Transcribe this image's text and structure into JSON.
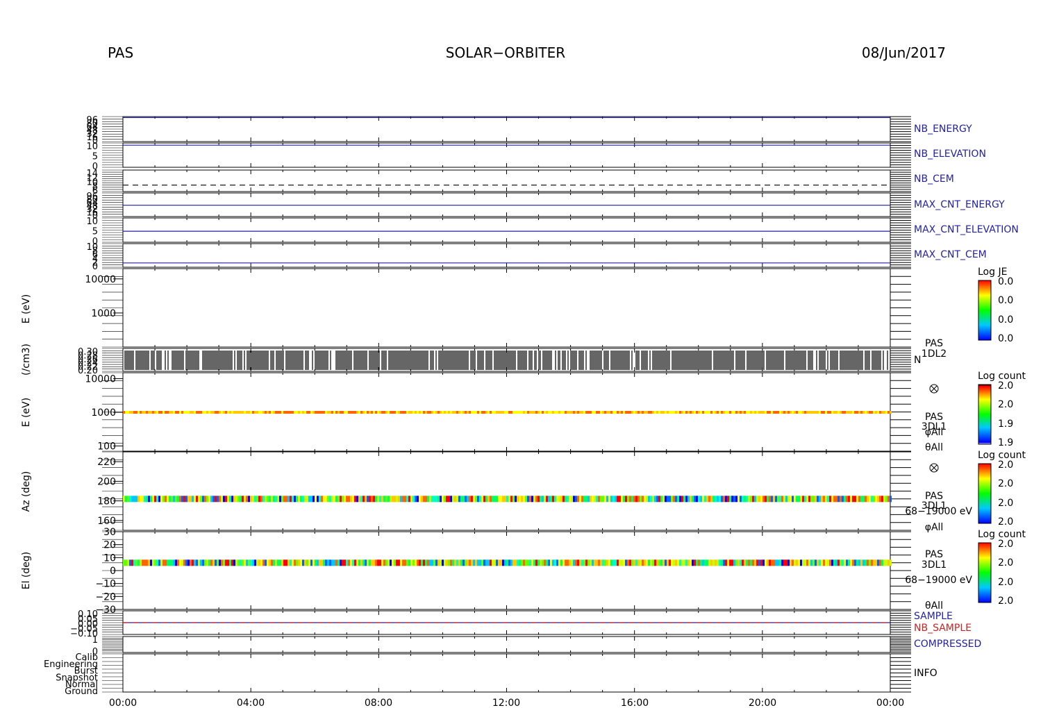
{
  "header": {
    "instrument": "PAS",
    "mission": "SOLAR−ORBITER",
    "date": "08/Jun/2017"
  },
  "colors": {
    "axis": "#000000",
    "label_blue": "#1f1fa8",
    "label_red": "#cc2222"
  },
  "chart_data": [
    {
      "type": "line",
      "name": "panel-nb-energy",
      "x_range": [
        "00:00",
        "24:00"
      ],
      "ytick_labels": [
        "96",
        "80",
        "64",
        "48",
        "32",
        "16",
        "0"
      ],
      "series": [
        {
          "name": "NB_ENERGY",
          "color": "#1f1fa8",
          "values": [
            96,
            96
          ]
        }
      ],
      "ylim": [
        0,
        100
      ],
      "labels": [
        "NB_ENERGY"
      ]
    },
    {
      "type": "line",
      "name": "panel-nb-elevation",
      "x_range": [
        "00:00",
        "24:00"
      ],
      "ytick_labels": [
        "10",
        "5",
        "0"
      ],
      "series": [
        {
          "name": "NB_ELEVATION",
          "color": "#1f1fa8",
          "values": [
            10,
            10
          ]
        }
      ],
      "ylim": [
        0,
        11
      ],
      "labels": [
        "NB_ELEVATION"
      ]
    },
    {
      "type": "line",
      "name": "panel-nb-cem",
      "x_range": [
        "00:00",
        "24:00"
      ],
      "ytick_labels": [
        "14",
        "12",
        "10",
        "8",
        "6"
      ],
      "series": [
        {
          "name": "NB_CEM",
          "color": "#000000",
          "style": "dashed",
          "values": [
            8,
            8
          ]
        }
      ],
      "ylim": [
        5,
        15
      ],
      "labels": [
        "NB_CEM"
      ]
    },
    {
      "type": "line",
      "name": "panel-max-cnt-energy",
      "x_range": [
        "00:00",
        "24:00"
      ],
      "ytick_labels": [
        "96",
        "80",
        "64",
        "48",
        "32",
        "16",
        "0"
      ],
      "series": [
        {
          "name": "MAX_CNT_ENERGY",
          "color": "#1f1fa8",
          "values": [
            48,
            48
          ]
        }
      ],
      "ylim": [
        0,
        100
      ],
      "labels": [
        "MAX_CNT_ENERGY"
      ]
    },
    {
      "type": "line",
      "name": "panel-max-cnt-elevation",
      "x_range": [
        "00:00",
        "24:00"
      ],
      "ytick_labels": [
        "10",
        "5",
        "0"
      ],
      "series": [
        {
          "name": "MAX_CNT_ELEVATION",
          "color": "#1f1fa8",
          "values": [
            5,
            5
          ]
        }
      ],
      "ylim": [
        0,
        11
      ],
      "labels": [
        "MAX_CNT_ELEVATION"
      ]
    },
    {
      "type": "line",
      "name": "panel-max-cnt-cem",
      "x_range": [
        "00:00",
        "24:00"
      ],
      "ytick_labels": [
        "10",
        "8",
        "6",
        "4",
        "2",
        "0"
      ],
      "series": [
        {
          "name": "MAX_CNT_CEM",
          "color": "#1f1fa8",
          "values": [
            2,
            2
          ]
        }
      ],
      "ylim": [
        0,
        11
      ],
      "labels": [
        "MAX_CNT_CEM"
      ]
    },
    {
      "type": "heatmap",
      "name": "panel-energy-je",
      "ylabel": "E (eV)",
      "yticks": [
        10000,
        1000
      ],
      "yscale": "log",
      "ylim": [
        100,
        20000
      ],
      "colorbar": {
        "title": "Log JE",
        "ticks": [
          "0.0",
          "0.0",
          "0.0",
          "0.0"
        ]
      }
    },
    {
      "type": "bar",
      "name": "panel-density",
      "ylabel": "(/cm3)",
      "ytick_labels": [
        "0.30",
        "0.28",
        "0.26",
        "0.24",
        "0.22",
        "0.20"
      ],
      "ylim": [
        0.2,
        0.3
      ],
      "series_labels": [
        "PAS",
        "1DL2",
        "N"
      ]
    },
    {
      "type": "heatmap",
      "name": "panel-energy-3dl1",
      "ylabel": "E (eV)",
      "yticks": [
        10000,
        1000,
        100
      ],
      "yscale": "log",
      "ylim": [
        70,
        15000
      ],
      "band_center": 1000,
      "colorbar": {
        "title": "Log count",
        "ticks": [
          "2.0",
          "2.0",
          "1.9",
          "1.9"
        ]
      },
      "series_labels": [
        "PAS",
        "3DL1",
        "φAll",
        "θAll"
      ]
    },
    {
      "type": "heatmap",
      "name": "panel-azimuth",
      "ylabel": "Az (deg)",
      "yticks": [
        220,
        200,
        180,
        160
      ],
      "ylim": [
        150,
        230
      ],
      "band_center": 182,
      "colorbar": {
        "title": "Log count",
        "ticks": [
          "2.0",
          "2.0",
          "2.0",
          "2.0"
        ]
      },
      "series_labels": [
        "PAS",
        "3DL1",
        "68−19000 eV",
        "φAll"
      ]
    },
    {
      "type": "heatmap",
      "name": "panel-elevation",
      "ylabel": "El (deg)",
      "yticks": [
        30,
        20,
        10,
        0,
        -10,
        -20,
        -30
      ],
      "ytick_labels": [
        "30",
        "20",
        "10",
        "0",
        "−10",
        "−20",
        "−30"
      ],
      "ylim": [
        -30,
        30
      ],
      "band_center": 6,
      "colorbar": {
        "title": "Log count",
        "ticks": [
          "2.0",
          "2.0",
          "2.0",
          "2.0"
        ]
      },
      "series_labels": [
        "PAS",
        "3DL1",
        "68−19000 eV",
        "θAll"
      ]
    },
    {
      "type": "line",
      "name": "panel-sample",
      "ytick_labels": [
        "0.10",
        "0.05",
        "0.00",
        "−0.05",
        "−0.10"
      ],
      "ylim": [
        -0.1,
        0.1
      ],
      "series": [
        {
          "name": "SAMPLE",
          "color": "#1f1fa8",
          "values": [
            0,
            0
          ]
        },
        {
          "name": "NB_SAMPLE",
          "color": "#cc2222",
          "style": "dashed",
          "values": [
            0,
            0
          ]
        }
      ],
      "labels": [
        "SAMPLE",
        "NB_SAMPLE"
      ]
    },
    {
      "type": "line",
      "name": "panel-compressed",
      "ytick_labels": [
        "1",
        "0"
      ],
      "ylim": [
        0,
        1
      ],
      "series": [
        {
          "name": "COMPRESSED",
          "color": "#1f1fa8",
          "values": []
        }
      ],
      "labels": [
        "COMPRESSED"
      ]
    },
    {
      "type": "line",
      "name": "panel-info",
      "ytick_labels": [
        "Calib",
        "Engineering",
        "Burst",
        "Snapshot",
        "Normal",
        "Ground"
      ],
      "series": [
        {
          "name": "INFO",
          "color": "#1f1fa8",
          "values": []
        }
      ],
      "labels": [
        "INFO"
      ]
    }
  ],
  "x_axis": {
    "tick_labels": [
      "00:00",
      "04:00",
      "08:00",
      "12:00",
      "16:00",
      "20:00",
      "00:00"
    ],
    "range_hours": [
      0,
      24
    ]
  }
}
